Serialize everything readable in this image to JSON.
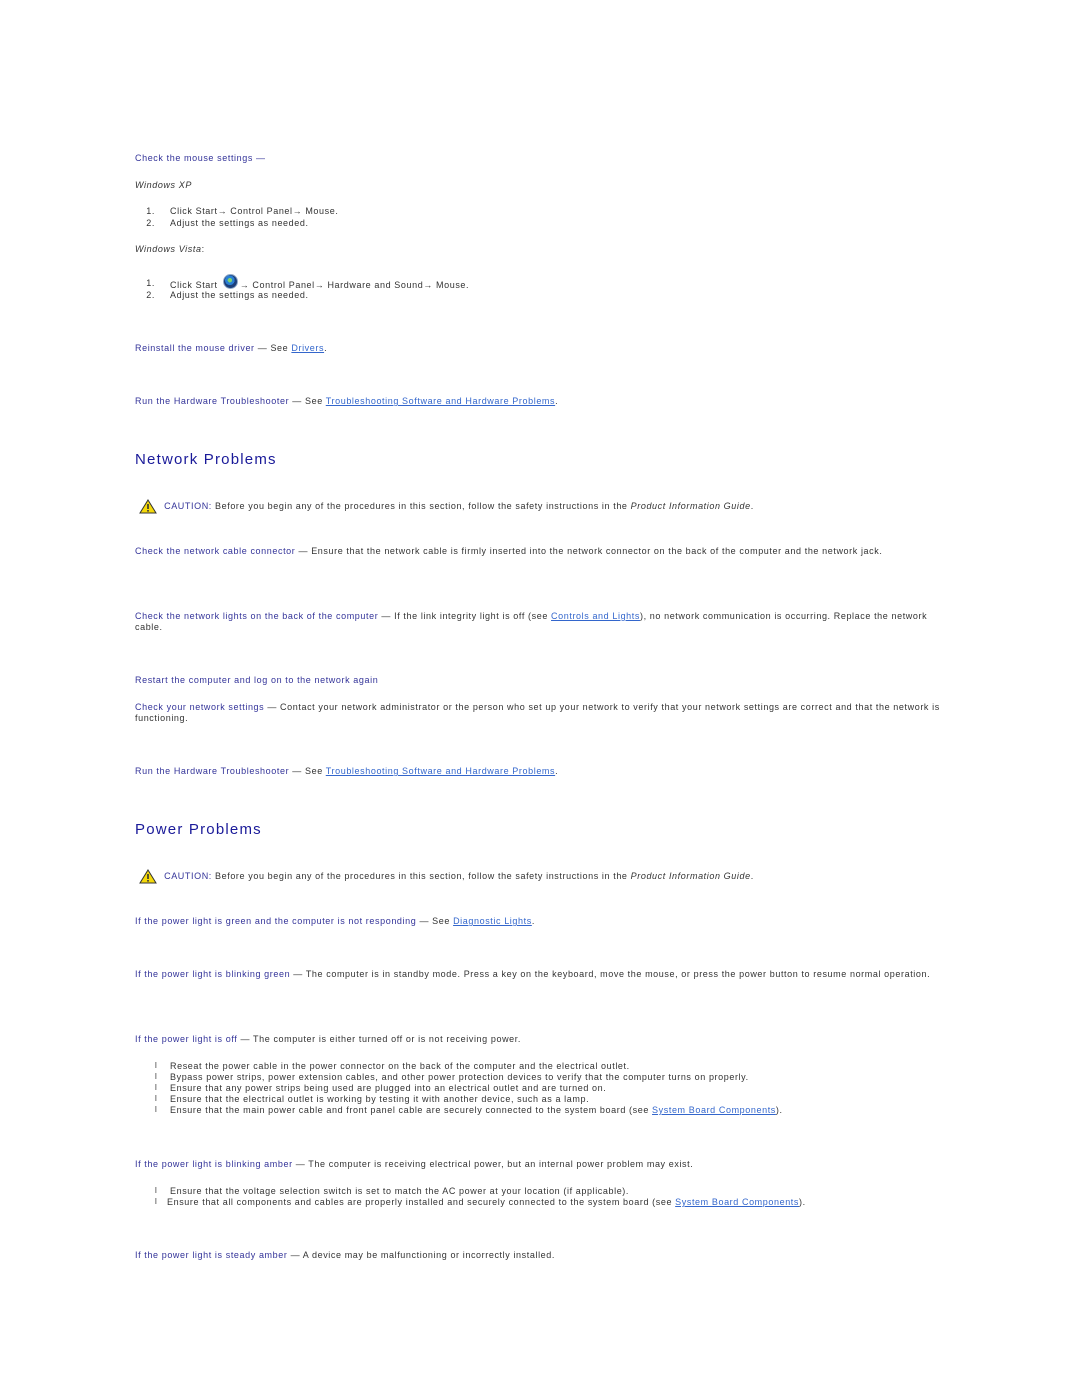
{
  "mouse": {
    "check_settings": "Check the mouse settings —",
    "xp_label": "Windows XP",
    "xp_steps": [
      {
        "num": "1.",
        "text": "Click Start→ Control Panel→ Mouse."
      },
      {
        "num": "2.",
        "text": "Adjust the settings as needed."
      }
    ],
    "vista_label": "Windows Vista",
    "vista_colon": ":",
    "vista_steps": [
      {
        "num": "1.",
        "pre": "Click Start",
        "post": "→ Control Panel→ Hardware and Sound→ Mouse."
      },
      {
        "num": "2.",
        "text": "Adjust the settings as needed."
      }
    ],
    "reinstall_label": "Reinstall the mouse driver",
    "reinstall_text": " — See ",
    "reinstall_link": "Drivers",
    "troubleshooter_label": "Run the Hardware Troubleshooter",
    "troubleshooter_text": " — See ",
    "troubleshooter_link": "Troubleshooting Software and Hardware Problems"
  },
  "network": {
    "title": "Network Problems",
    "caution_label": "CAUTION:",
    "caution_text": " Before you begin any of the procedures in this section, follow the safety instructions in the ",
    "caution_guide": "Product Information Guide",
    "cable_label": "Check the network cable connector",
    "cable_text": " — Ensure that the network cable is firmly inserted into the network connector on the back of the computer and the network jack.",
    "lights_label": "Check the network lights on the back of the computer",
    "lights_text1": " — If the link integrity light is off (see ",
    "lights_link": "Controls and Lights",
    "lights_text2": "), no network communication is occurring. Replace the network cable.",
    "restart_label": "Restart the computer and log on to the network again",
    "settings_label": "Check your network settings",
    "settings_text": " — Contact your network administrator or the person who set up your network to verify that your network settings are correct and that the network is functioning.",
    "troubleshooter_label": "Run the Hardware Troubleshooter",
    "troubleshooter_text": " — See ",
    "troubleshooter_link": "Troubleshooting Software and Hardware Problems"
  },
  "power": {
    "title": "Power Problems",
    "caution_label": "CAUTION:",
    "caution_text": " Before you begin any of the procedures in this section, follow the safety instructions in the ",
    "caution_guide": "Product Information Guide",
    "green_label": "If the power light is green and the computer is not responding",
    "green_text": " — See ",
    "green_link": "Diagnostic Lights",
    "blink_green_label": "If the power light is blinking green",
    "blink_green_text": " — The computer is in standby mode. Press a key on the keyboard, move the mouse, or press the power button to resume normal operation.",
    "off_label": "If the power light is off",
    "off_text": " — The computer is either turned off or is not receiving power.",
    "off_bullets": [
      "Reseat the power cable in the power connector on the back of the computer and the electrical outlet.",
      "Bypass power strips, power extension cables, and other power protection devices to verify that the computer turns on properly.",
      "Ensure that any power strips being used are plugged into an electrical outlet and are turned on.",
      "Ensure that the electrical outlet is working by testing it with another device, such as a lamp.",
      "Ensure that the main power cable and front panel cable are securely connected to the system board (see "
    ],
    "off_bullet_link": "System Board Components",
    "blink_amber_label": "If the power light is blinking amber",
    "blink_amber_text": " — The computer is receiving electrical power, but an internal power problem may exist.",
    "amber_bullets": [
      "Ensure that the voltage selection switch is set to match the AC power at your location (if applicable).",
      "Ensure that all components and cables are properly installed and securely connected to the system board (see "
    ],
    "amber_bullet_link": "System Board Components",
    "steady_amber_label": "If the power light is steady amber",
    "steady_amber_text": " — A device may be malfunctioning or incorrectly installed."
  },
  "bullet_glyph": "l",
  "period": ".",
  "close_paren": ")."
}
